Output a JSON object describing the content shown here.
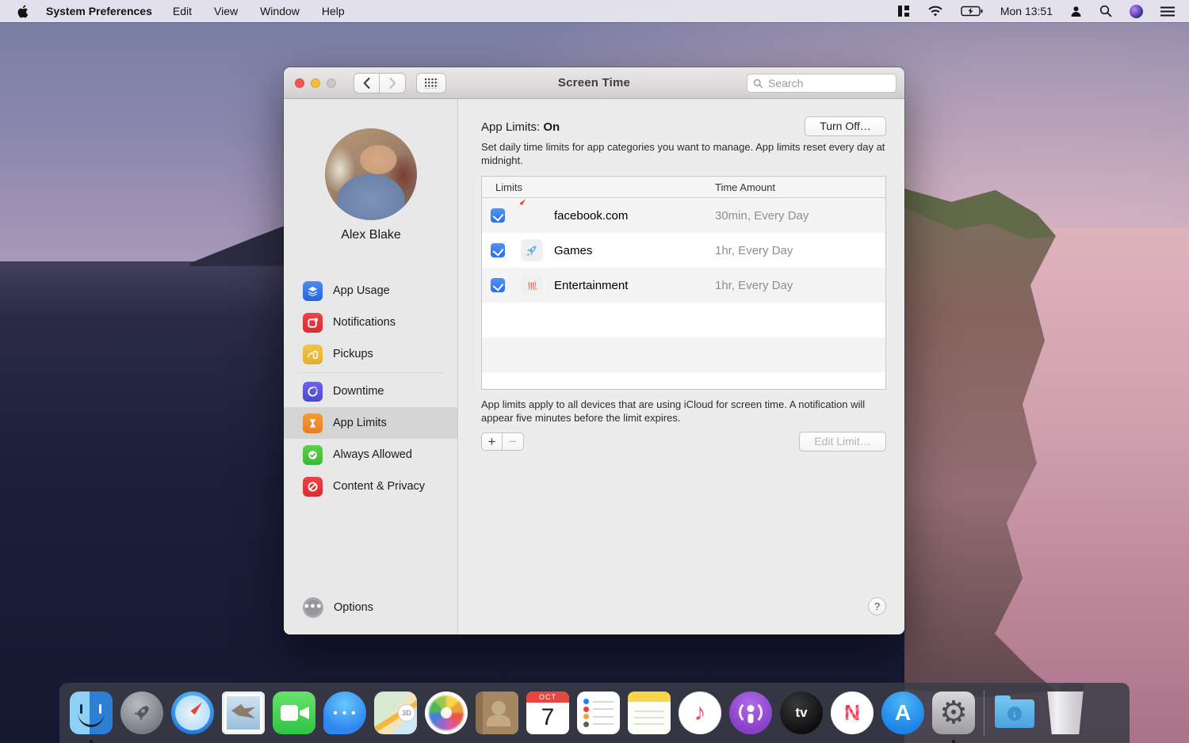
{
  "colors": {
    "accent_blue": "#2a6fee",
    "sidebar_selected": "#d5d4d4",
    "app_usage": "#2d6fe4",
    "notifications": "#e5393e",
    "pickups": "#edbf3e",
    "downtime": "#5a55d8",
    "app_limits": "#ef8e2e",
    "always_allowed": "#4cc93f",
    "content_privacy": "#e5393e"
  },
  "menu_bar": {
    "app_name": "System Preferences",
    "menus": [
      "Edit",
      "View",
      "Window",
      "Help"
    ],
    "clock": "Mon 13:51"
  },
  "window": {
    "title": "Screen Time",
    "search_placeholder": "Search",
    "sidebar": {
      "user_name": "Alex Blake",
      "group1": [
        {
          "label": "App Usage"
        },
        {
          "label": "Notifications"
        },
        {
          "label": "Pickups"
        }
      ],
      "group2": [
        {
          "label": "Downtime"
        },
        {
          "label": "App Limits",
          "selected": true
        },
        {
          "label": "Always Allowed"
        },
        {
          "label": "Content & Privacy"
        }
      ],
      "options_label": "Options"
    },
    "content": {
      "heading_prefix": "App Limits:",
      "heading_status": "On",
      "turn_off_label": "Turn Off…",
      "description": "Set daily time limits for app categories you want to manage. App limits reset every day at midnight.",
      "table": {
        "columns": [
          "Limits",
          "Time Amount"
        ],
        "rows": [
          {
            "checked": true,
            "icon": "safari-compass",
            "name": "facebook.com",
            "time": "30min, Every Day"
          },
          {
            "checked": true,
            "icon": "rocket",
            "name": "Games",
            "time": "1hr, Every Day"
          },
          {
            "checked": true,
            "icon": "popcorn",
            "name": "Entertainment",
            "time": "1hr, Every Day"
          }
        ]
      },
      "footnote": "App limits apply to all devices that are using iCloud for screen time. A notification will appear five minutes before the limit expires.",
      "add_label": "+",
      "remove_label": "−",
      "edit_limit_label": "Edit Limit…",
      "help_label": "?"
    }
  },
  "dock": {
    "items": [
      "finder",
      "launchpad",
      "safari",
      "mail",
      "facetime",
      "messages",
      "maps",
      "photos",
      "contacts",
      "calendar",
      "reminders",
      "notes",
      "music",
      "podcasts",
      "apple-tv",
      "news",
      "app-store",
      "system-preferences",
      "downloads",
      "trash"
    ],
    "running": [
      "finder",
      "system-preferences"
    ],
    "calendar_month": "OCT",
    "calendar_day": "7",
    "apple_tv_glyph": "tv",
    "app_store_glyph": "A",
    "news_glyph": "N",
    "music_glyph": "♪",
    "sysprefs_glyph": "⚙",
    "downloads_glyph": "↓"
  }
}
